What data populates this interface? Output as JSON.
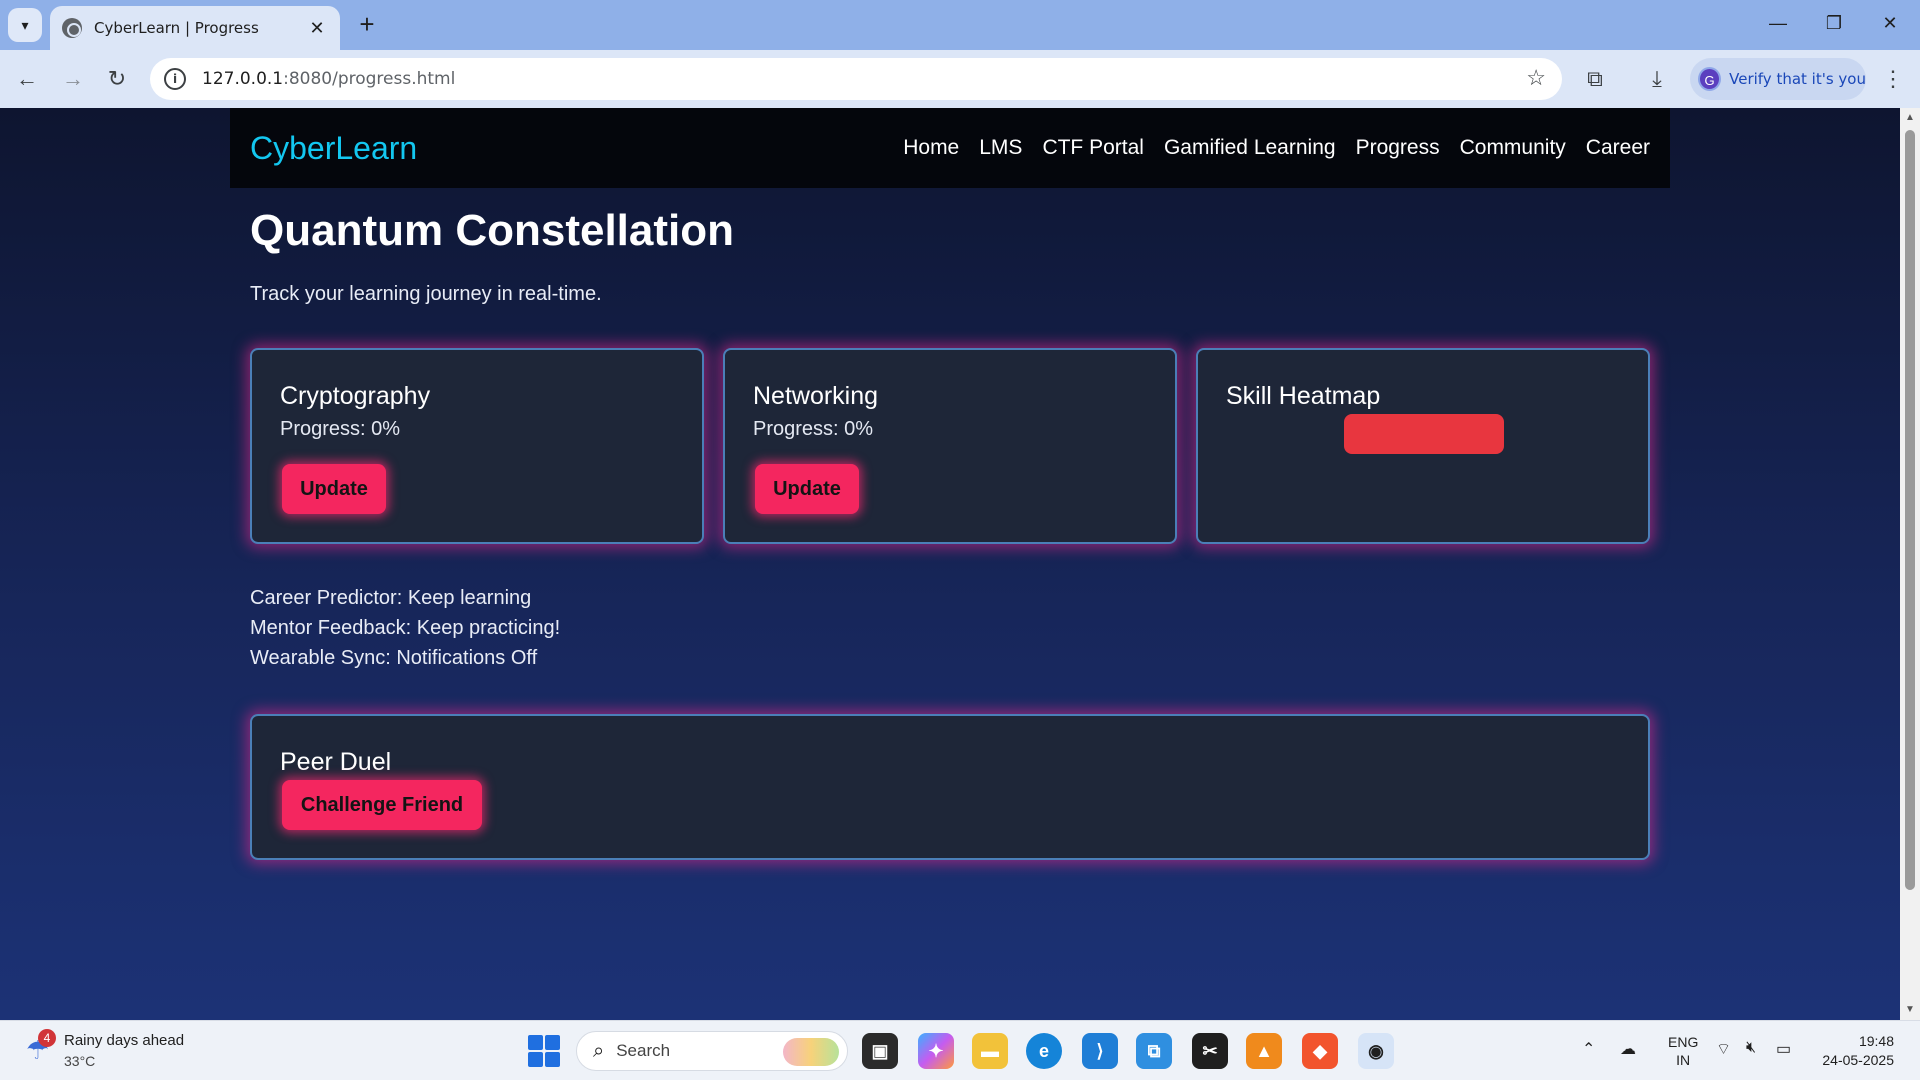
{
  "browser": {
    "tab_title": "CyberLearn | Progress",
    "url_host": "127.0.0.1",
    "url_path": ":8080/progress.html",
    "verify_label": "Verify that it's you",
    "profile_initial": "G"
  },
  "site": {
    "brand": "CyberLearn",
    "nav": [
      "Home",
      "LMS",
      "CTF Portal",
      "Gamified Learning",
      "Progress",
      "Community",
      "Career"
    ]
  },
  "page": {
    "title": "Quantum Constellation",
    "subtitle": "Track your learning journey in real-time."
  },
  "cards": {
    "cryptography": {
      "title": "Cryptography",
      "progress": "Progress: 0%",
      "button": "Update"
    },
    "networking": {
      "title": "Networking",
      "progress": "Progress: 0%",
      "button": "Update"
    },
    "heatmap": {
      "title": "Skill Heatmap",
      "bar_color": "#e8363f"
    }
  },
  "info": {
    "career": "Career Predictor: Keep learning",
    "mentor": "Mentor Feedback: Keep practicing!",
    "wearable": "Wearable Sync: Notifications Off"
  },
  "peer_duel": {
    "title": "Peer Duel",
    "button": "Challenge Friend"
  },
  "colors": {
    "accent_pink": "#f4265f",
    "brand_cyan": "#13c7f0",
    "card_bg": "#1e2638"
  },
  "taskbar": {
    "weather_title": "Rainy days ahead",
    "weather_temp": "33°C",
    "weather_badge": "4",
    "search_label": "Search",
    "lang_top": "ENG",
    "lang_bottom": "IN",
    "time": "19:48",
    "date": "24-05-2025"
  }
}
